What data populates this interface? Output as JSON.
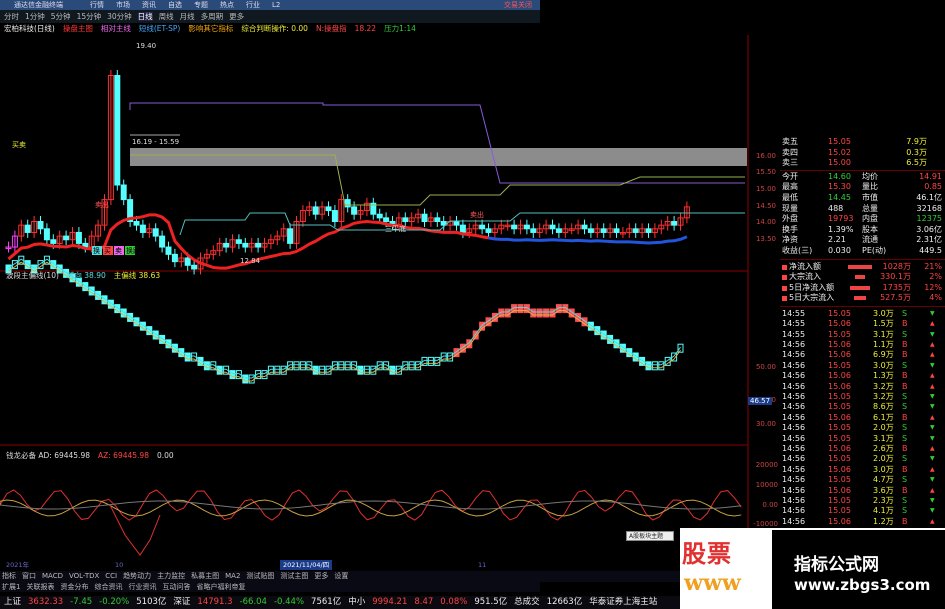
{
  "window": {
    "title": "通达信金融终端",
    "close_label": "交易关闭"
  },
  "menu": [
    "行情",
    "市场",
    "资讯",
    "自选",
    "专题",
    "热点",
    "行业",
    "L2"
  ],
  "toolbar": {
    "items": [
      "分时",
      "1分钟",
      "5分钟",
      "15分钟",
      "30分钟",
      "日线",
      "周线",
      "月线",
      "多周期",
      "更多"
    ],
    "selected": "日线"
  },
  "main_header": [
    "宏柏科技(日线)",
    "操盘主图",
    "相对主线",
    "短线(ET-SP)",
    "影响其它指标",
    "综合判断操作: 0.00",
    "N:操盘指",
    "18.22",
    "压力1:14"
  ],
  "price_labels": {
    "high": "19.40",
    "low": "12.84",
    "band": "16.19 - 15.59",
    "buy_tag": "买卖",
    "sell_tag": "卖出",
    "three_flat": "三平底",
    "mid_tag": "卖出"
  },
  "main_axis": [
    "16.00",
    "15.50",
    "15.00",
    "14.50",
    "14.00",
    "13.50"
  ],
  "sub1_header": [
    "波段主偏线(10)",
    "转向 38.90",
    "主偏线 38.63"
  ],
  "sub1_tags": [
    "换",
    "买",
    "卖",
    "换跌"
  ],
  "sub1_axis": [
    "50.00",
    "40.00",
    "30.00"
  ],
  "sub1_marker": "46.57",
  "sub2_header": [
    "钱龙必备  AD: 69445.98",
    "AZ: 69445.98",
    "0.00"
  ],
  "sub2_axis": [
    "20000",
    "10000",
    "0.00",
    "-10000"
  ],
  "date_bar": {
    "left": "2021年",
    "mid": "10",
    "date": "2021/11/04/四",
    "right": "11"
  },
  "bottom_tabs1": [
    "指标",
    "窗口",
    "MACD",
    "VOL-TDX",
    "CCI",
    "趋势动力",
    "主力监控",
    "私募主图",
    "MA2",
    "测试贴图",
    "测试主图",
    "更多",
    "设置"
  ],
  "bottom_tabs2": [
    "扩展1",
    "关联报表",
    "资金分布",
    "综合资讯",
    "行业资讯",
    "互动问答",
    "省略户福利帝复"
  ],
  "status": [
    {
      "t": "上证",
      "c": "white"
    },
    {
      "t": "3632.33",
      "c": "red"
    },
    {
      "t": "-7.45",
      "c": "green"
    },
    {
      "t": "-0.20%",
      "c": "green"
    },
    {
      "t": "5103亿",
      "c": "white"
    },
    {
      "t": "深证",
      "c": "white"
    },
    {
      "t": "14791.3",
      "c": "red"
    },
    {
      "t": "-66.04",
      "c": "green"
    },
    {
      "t": "-0.44%",
      "c": "green"
    },
    {
      "t": "7561亿",
      "c": "white"
    },
    {
      "t": "中小",
      "c": "white"
    },
    {
      "t": "9994.21",
      "c": "red"
    },
    {
      "t": "8.47",
      "c": "red"
    },
    {
      "t": "0.08%",
      "c": "red"
    },
    {
      "t": "951.5亿",
      "c": "white"
    },
    {
      "t": "总成交",
      "c": "white"
    },
    {
      "t": "12663亿",
      "c": "white"
    },
    {
      "t": "华泰证券上海主站",
      "c": "white"
    }
  ],
  "popup": "A股板块主题",
  "orderbook": [
    {
      "label": "卖五",
      "price": "15.05",
      "vol": "7.9万"
    },
    {
      "label": "卖四",
      "price": "15.02",
      "vol": "0.3万"
    },
    {
      "label": "卖三",
      "price": "15.00",
      "vol": "6.5万"
    }
  ],
  "quote": [
    {
      "l1": "今开",
      "v1": "14.60",
      "c1": "green",
      "l2": "均价",
      "v2": "14.91",
      "c2": "red"
    },
    {
      "l1": "最高",
      "v1": "15.30",
      "c1": "red",
      "l2": "量比",
      "v2": "0.85",
      "c2": "red"
    },
    {
      "l1": "最低",
      "v1": "14.45",
      "c1": "green",
      "l2": "市值",
      "v2": "46.1亿",
      "c2": "white"
    },
    {
      "l1": "现量",
      "v1": "488",
      "c1": "white",
      "l2": "总量",
      "v2": "32168",
      "c2": "white"
    },
    {
      "l1": "外盘",
      "v1": "19793",
      "c1": "red",
      "l2": "内盘",
      "v2": "12375",
      "c2": "green"
    },
    {
      "l1": "换手",
      "v1": "1.39%",
      "c1": "white",
      "l2": "股本",
      "v2": "3.06亿",
      "c2": "white"
    },
    {
      "l1": "净资",
      "v1": "2.21",
      "c1": "white",
      "l2": "流通",
      "v2": "2.31亿",
      "c2": "white"
    },
    {
      "l1": "收益(三)",
      "v1": "0.030",
      "c1": "white",
      "l2": "PE(动)",
      "v2": "449.5",
      "c2": "white"
    }
  ],
  "flows": [
    {
      "label": "净流入额",
      "val": "1028万",
      "pct": "21%"
    },
    {
      "label": "大宗流入",
      "val": "330.1万",
      "pct": "2%"
    },
    {
      "label": "5日净流入额",
      "val": "1735万",
      "pct": "12%"
    },
    {
      "label": "5日大宗流入",
      "val": "527.5万",
      "pct": "4%"
    }
  ],
  "ticks": [
    {
      "time": "14:55",
      "price": "15.05",
      "vol": "3.0万",
      "bs": "S"
    },
    {
      "time": "14:55",
      "price": "15.06",
      "vol": "1.5万",
      "bs": "B"
    },
    {
      "time": "14:55",
      "price": "15.05",
      "vol": "3.1万",
      "bs": "S"
    },
    {
      "time": "14:56",
      "price": "15.06",
      "vol": "1.1万",
      "bs": "B"
    },
    {
      "time": "14:56",
      "price": "15.06",
      "vol": "6.9万",
      "bs": "B"
    },
    {
      "time": "14:56",
      "price": "15.05",
      "vol": "3.0万",
      "bs": "S"
    },
    {
      "time": "14:56",
      "price": "15.06",
      "vol": "1.3万",
      "bs": "B"
    },
    {
      "time": "14:56",
      "price": "15.06",
      "vol": "3.2万",
      "bs": "B"
    },
    {
      "time": "14:56",
      "price": "15.05",
      "vol": "3.2万",
      "bs": "S"
    },
    {
      "time": "14:56",
      "price": "15.05",
      "vol": "8.6万",
      "bs": "S"
    },
    {
      "time": "14:56",
      "price": "15.06",
      "vol": "6.1万",
      "bs": "B"
    },
    {
      "time": "14:56",
      "price": "15.05",
      "vol": "2.0万",
      "bs": "S"
    },
    {
      "time": "14:56",
      "price": "15.05",
      "vol": "3.1万",
      "bs": "S"
    },
    {
      "time": "14:56",
      "price": "15.06",
      "vol": "2.6万",
      "bs": "B"
    },
    {
      "time": "14:56",
      "price": "15.05",
      "vol": "2.0万",
      "bs": "S"
    },
    {
      "time": "14:56",
      "price": "15.06",
      "vol": "3.0万",
      "bs": "B"
    },
    {
      "time": "14:56",
      "price": "15.05",
      "vol": "4.7万",
      "bs": "S"
    },
    {
      "time": "14:56",
      "price": "15.06",
      "vol": "3.6万",
      "bs": "B"
    },
    {
      "time": "14:56",
      "price": "15.05",
      "vol": "2.3万",
      "bs": "S"
    },
    {
      "time": "14:56",
      "price": "15.05",
      "vol": "4.1万",
      "bs": "S"
    },
    {
      "time": "14:56",
      "price": "15.06",
      "vol": "1.2万",
      "bs": "B"
    }
  ],
  "watermark": {
    "left1": "股票",
    "left2": "www",
    "site1": "指标公式网",
    "site2": "www.zbgs3.com"
  }
}
